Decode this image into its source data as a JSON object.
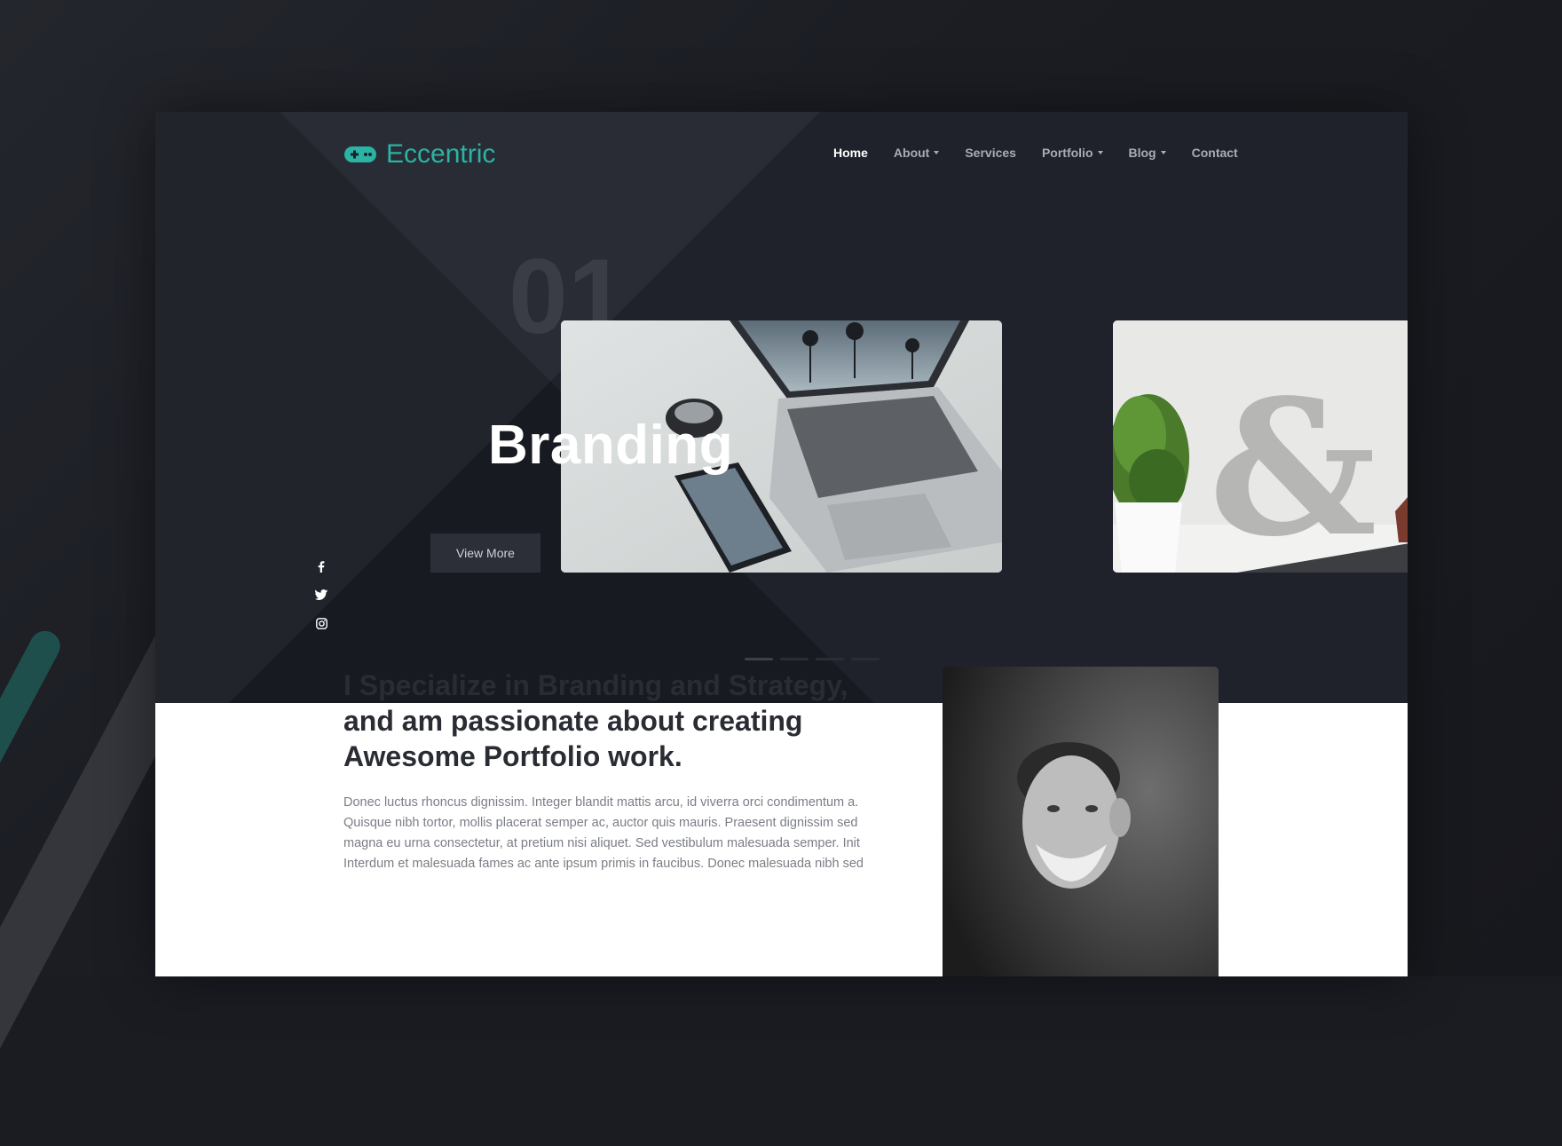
{
  "brand": {
    "name": "Eccentric",
    "accent": "#2bb3a3",
    "icon": "gamepad-icon"
  },
  "nav": {
    "items": [
      {
        "label": "Home",
        "active": true,
        "has_caret": false
      },
      {
        "label": "About",
        "active": false,
        "has_caret": true
      },
      {
        "label": "Services",
        "active": false,
        "has_caret": false
      },
      {
        "label": "Portfolio",
        "active": false,
        "has_caret": true
      },
      {
        "label": "Blog",
        "active": false,
        "has_caret": true
      },
      {
        "label": "Contact",
        "active": false,
        "has_caret": false
      }
    ]
  },
  "hero": {
    "slide_number": "01",
    "slide_title": "Branding",
    "cta_label": "View More",
    "social": [
      "facebook-icon",
      "twitter-icon",
      "instagram-icon"
    ],
    "slides_count": 4,
    "active_slide": 1
  },
  "about": {
    "title": "I Specialize in Branding and Strategy, and am passionate about creating Awesome Portfolio work.",
    "text": "Donec luctus rhoncus dignissim. Integer blandit mattis arcu, id viverra orci condimentum a. Quisque nibh tortor, mollis placerat semper ac, auctor quis mauris. Praesent dignissim sed magna eu urna consectetur, at pretium nisi aliquet. Sed vestibulum malesuada semper. Init Interdum et malesuada fames ac ante ipsum primis in faucibus. Donec malesuada nibh sed"
  }
}
